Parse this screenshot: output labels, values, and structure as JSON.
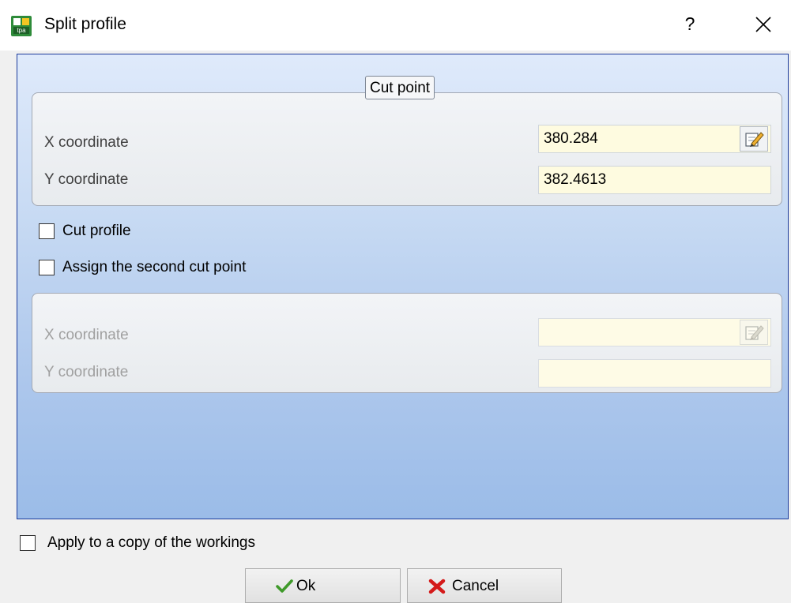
{
  "window": {
    "title": "Split profile",
    "help_label": "?",
    "icon": "app-icon",
    "close_icon": "close-icon"
  },
  "cut_point_group": {
    "legend": "Cut point",
    "x_label": "X coordinate",
    "x_value": "380.284",
    "y_label": "Y coordinate",
    "y_value": "382.4613",
    "pick_icon": "pick-point-icon"
  },
  "options": {
    "cut_profile": {
      "label": "Cut profile",
      "checked": false
    },
    "second_point": {
      "label": "Assign the second cut point",
      "checked": false
    }
  },
  "second_point_group": {
    "x_label": "X coordinate",
    "x_value": "",
    "y_label": "Y coordinate",
    "y_value": "",
    "enabled": false
  },
  "apply_copy": {
    "label": "Apply to a copy of the workings",
    "checked": false
  },
  "buttons": {
    "ok_label": "Ok",
    "ok_icon": "checkmark-icon",
    "cancel_label": "Cancel",
    "cancel_icon": "red-x-icon"
  },
  "colors": {
    "panel_gradient_top": "#dfeafb",
    "panel_gradient_bottom": "#9bbce8",
    "field_background": "#fefbe0",
    "panel_border": "#1c3b9b"
  }
}
